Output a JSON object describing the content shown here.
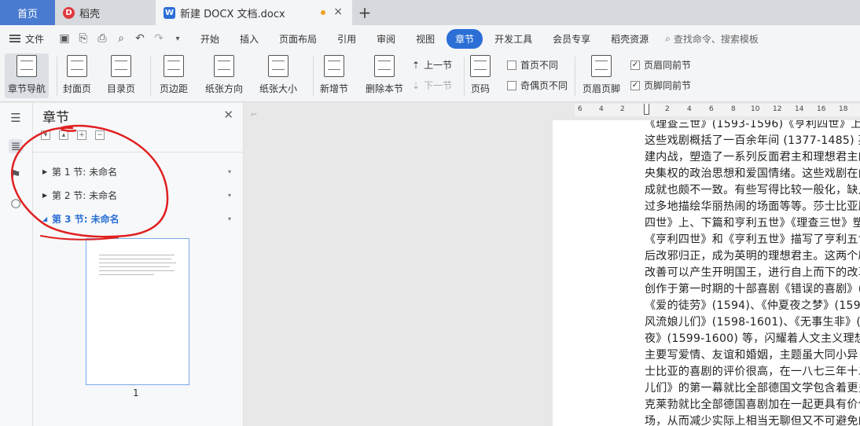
{
  "tabs": {
    "home": "首页",
    "dk": "稻壳",
    "doc": "新建 DOCX 文档.docx",
    "close": "×",
    "add": "+"
  },
  "menu": {
    "file": "文件",
    "items": [
      "开始",
      "插入",
      "页面布局",
      "引用",
      "审阅",
      "视图",
      "章节",
      "开发工具",
      "会员专享",
      "稻壳资源"
    ],
    "active_index": 6,
    "search": "查找命令、搜索模板"
  },
  "ribbon": {
    "nav": "章节导航",
    "cover": "封面页",
    "toc": "目录页",
    "margin": "页边距",
    "orientation": "纸张方向",
    "size": "纸张大小",
    "new_section": "新增节",
    "delete_section": "删除本节",
    "prev_section": "上一节",
    "next_section": "下一节",
    "page_num": "页码",
    "first_diff": "首页不同",
    "odd_even_diff": "奇偶页不同",
    "header_footer": "页眉页脚",
    "header_same": "页眉同前节",
    "footer_same": "页脚同前节"
  },
  "pane": {
    "title": "章节",
    "sections": [
      "第 1 节: 未命名",
      "第 2 节: 未命名",
      "第 3 节: 未命名"
    ],
    "active_section": 2,
    "page_number": "1"
  },
  "ruler": [
    "6",
    "4",
    "2",
    "2",
    "4",
    "6",
    "8",
    "10",
    "12",
    "14",
    "16",
    "18"
  ],
  "document": {
    "lines": [
      "《理查三世》(1593-1596)《亨利四世》上、",
      "这些戏剧概括了一百余年间 (1377-1485) 英",
      "建内战，塑造了一系列反面君主和理想君主的",
      "央集权的政治思想和爱国情绪。这些戏剧在内",
      "成就也颇不一致。有些写得比较一般化，缺点",
      "过多地描绘华丽热闹的场面等等。莎士比亚历",
      "四世》上、下篇和亨利五世》《理查三世》塑",
      "《亨利四世》和《亨利五世》描写了亨利五世",
      "后改邪归正，成为英明的理想君主。这两个剧",
      "改善可以产生开明国王，进行自上而下的改革",
      "创作于第一时期的十部喜剧《错误的喜剧》(15",
      "《爱的徒劳》(1594)、《仲夏夜之梦》(1595-",
      "风流娘儿们》(1598-1601)、《无事生非》(159",
      "夜》(1599-1600) 等，闪耀着人文主义理想的",
      "主要写爱情、友谊和婚姻，主题虽大同小异，",
      "士比亚的喜剧的评价很高，在一八七三年十二",
      "儿们》的第一幕就比全部德国文学包含着更多",
      "克莱勃就比全部德国喜剧加在一起更具有价值",
      "场，从而减少实际上相当无聊但又不可避免的"
    ]
  },
  "colors": {
    "accent": "#2b6fd6",
    "annotation": "#e02020"
  }
}
